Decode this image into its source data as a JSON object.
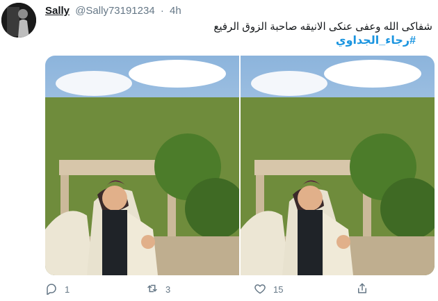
{
  "tweet": {
    "display_name": "Sally",
    "handle": "@Sally73191234",
    "separator": "·",
    "time": "4h",
    "text": "شفاكى الله وعفى عنكى الانيقه صاحبة الزوق الرفيع",
    "hashtag": "#رجاء_الجداوي",
    "avatar_icon": "user-avatar",
    "media_count": 2
  },
  "actions": {
    "reply_count": "1",
    "retweet_count": "3",
    "like_count": "15",
    "reply_icon": "reply-icon",
    "retweet_icon": "retweet-icon",
    "like_icon": "heart-icon",
    "share_icon": "share-icon"
  },
  "colors": {
    "link": "#1b95e0",
    "muted": "#657786",
    "text": "#14171a"
  }
}
